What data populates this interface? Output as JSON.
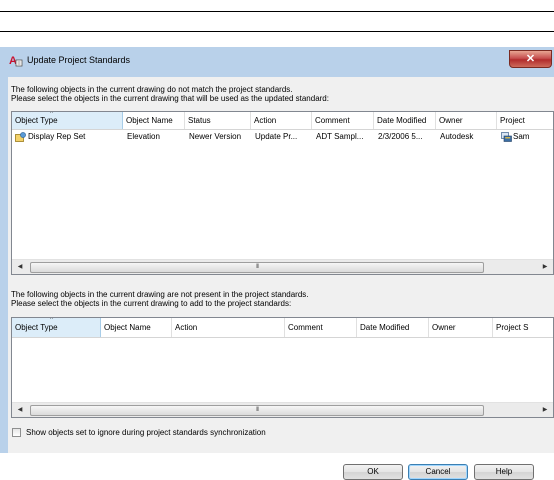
{
  "dialog": {
    "title": "Update Project Standards",
    "close_glyph": "✕",
    "colors": {
      "frame": "#b9d1ea",
      "client": "#f0f0f0",
      "close": "#c75050",
      "sorted_header": "#dcedf9"
    }
  },
  "top_section": {
    "line1": "The following objects in the current drawing do not match the project standards.",
    "line2": "Please select the objects in the current drawing that will be used as the updated standard:",
    "columns": [
      "Object Type",
      "Object Name",
      "Status",
      "Action",
      "Comment",
      "Date Modified",
      "Owner",
      "Project"
    ],
    "rows": [
      {
        "icon": "display-rep-set-icon",
        "object_type": "Display Rep Set",
        "object_name": "Elevation",
        "status": "Newer Version",
        "action": "Update Pr...",
        "comment": "ADT Sampl...",
        "date_modified": "2/3/2006 5...",
        "owner": "Autodesk",
        "project_icon": "project-standards-icon",
        "project": "Sam"
      }
    ]
  },
  "bottom_section": {
    "line1": "The following objects in the current drawing are not present in the project standards.",
    "line2": "Please select the objects in the current drawing to add to the project standards:",
    "columns": [
      "Object Type",
      "Object Name",
      "Action",
      "Comment",
      "Date Modified",
      "Owner",
      "Project S"
    ],
    "rows": []
  },
  "scrollbar": {
    "left_arrow": "◀",
    "right_arrow": "▶",
    "grip": "III"
  },
  "checkbox": {
    "label": "Show objects set to ignore during project standards synchronization",
    "checked": false
  },
  "buttons": {
    "ok": "OK",
    "cancel": "Cancel",
    "help": "Help"
  },
  "sort_indicator": "^"
}
